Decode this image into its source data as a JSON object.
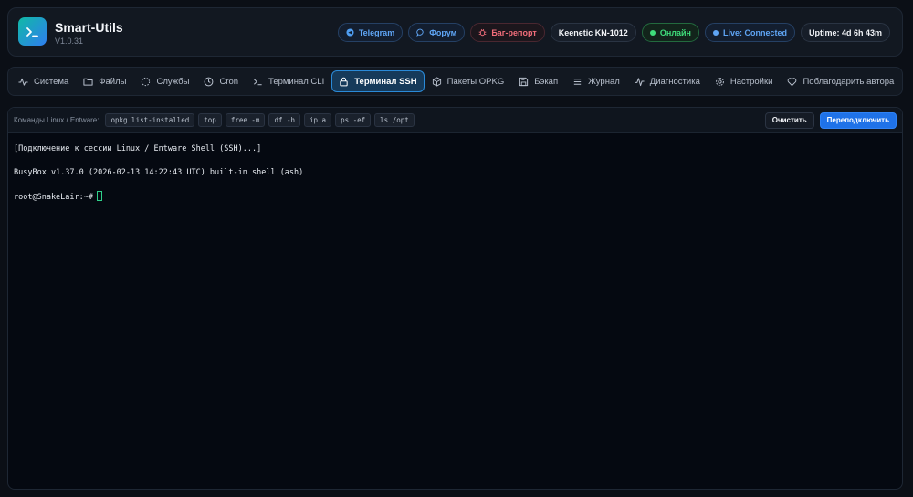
{
  "app": {
    "title": "Smart-Utils",
    "version": "V1.0.31",
    "accent_gradient": [
      "#10b9a6",
      "#2f7ef0"
    ]
  },
  "header": {
    "pills": [
      {
        "label": "Telegram",
        "icon": "telegram-icon",
        "style": "blue"
      },
      {
        "label": "Форум",
        "icon": "chat-icon",
        "style": "blue"
      },
      {
        "label": "Баг-репорт",
        "icon": "bug-icon",
        "style": "red"
      },
      {
        "label": "Keenetic KN-1012",
        "icon": "",
        "style": "plain"
      },
      {
        "label": "Онлайн",
        "icon": "status-dot-icon",
        "style": "green"
      },
      {
        "label": "Live: Connected",
        "icon": "status-dot-icon",
        "style": "blue"
      },
      {
        "label": "Uptime: 4d 6h 43m",
        "icon": "",
        "style": "plain"
      }
    ]
  },
  "nav": {
    "tabs": [
      {
        "label": "Система",
        "icon": "activity-icon"
      },
      {
        "label": "Файлы",
        "icon": "folder-icon"
      },
      {
        "label": "Службы",
        "icon": "loader-icon"
      },
      {
        "label": "Cron",
        "icon": "clock-icon"
      },
      {
        "label": "Терминал CLI",
        "icon": "terminal-icon"
      },
      {
        "label": "Терминал SSH",
        "icon": "lock-icon",
        "active": true
      },
      {
        "label": "Пакеты OPKG",
        "icon": "package-icon"
      },
      {
        "label": "Бэкап",
        "icon": "save-icon"
      },
      {
        "label": "Журнал",
        "icon": "list-icon"
      },
      {
        "label": "Диагностика",
        "icon": "pulse-icon"
      },
      {
        "label": "Настройки",
        "icon": "gear-icon"
      },
      {
        "label": "Поблагодарить автора",
        "icon": "heart-icon"
      }
    ]
  },
  "toolbar": {
    "label": "Команды Linux / Entware:",
    "commands": [
      "opkg list-installed",
      "top",
      "free -m",
      "df -h",
      "ip a",
      "ps -ef",
      "ls /opt"
    ],
    "clear_label": "Очистить",
    "reconnect_label": "Переподключить"
  },
  "terminal": {
    "line1": "[Подключение к сессии Linux / Entware Shell (SSH)...]",
    "line2": "BusyBox v1.37.0 (2026-02-13 14:22:43 UTC) built-in shell (ash)",
    "prompt": "root@SnakeLair:~#"
  },
  "colors": {
    "background": "#0b0f16",
    "active_tab": "#163a5a",
    "primary_button": "#1f72e8",
    "online_green": "#3fdd7b",
    "live_blue": "#5fa5f5",
    "bug_red": "#f16d7a"
  }
}
